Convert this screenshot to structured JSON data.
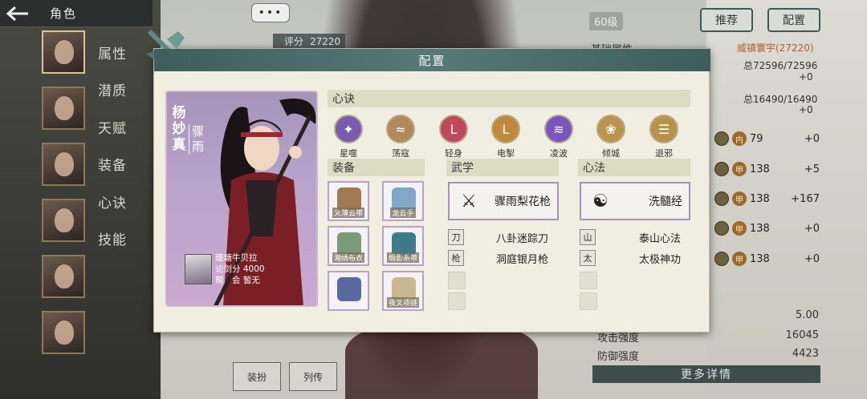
{
  "topbar": {
    "back_icon": "arrow-left-icon",
    "title": "角色"
  },
  "sidebar": {
    "tabs": [
      "属性",
      "潜质",
      "天赋",
      "装备",
      "心诀",
      "技能"
    ]
  },
  "background": {
    "chat_bubble": "•••",
    "score_label": "评分",
    "score_value": "27220",
    "level": "60级",
    "recommend_button": "推荐",
    "config_button": "配置",
    "base_attr_title": "基础属性",
    "base_attr_value": "威镇寰宇(27220)",
    "hp_line": "总72596/72596",
    "hp_plus": "+0",
    "mp_line": "总16490/16490",
    "mp_plus": "+0",
    "stat_rows": [
      {
        "badge": "内",
        "n1": "79",
        "n2": "+0"
      },
      {
        "badge": "甲",
        "n1": "138",
        "n2": "+5"
      },
      {
        "badge": "甲",
        "n1": "138",
        "n2": "+167"
      },
      {
        "badge": "甲",
        "n1": "138",
        "n2": "+0"
      },
      {
        "badge": "甲",
        "n1": "138",
        "n2": "+0"
      }
    ],
    "bottom_stats": [
      {
        "label": "",
        "value": "5.00"
      },
      {
        "label": "攻击强度",
        "value": "16045"
      },
      {
        "label": "防御强度",
        "value": "4423"
      }
    ],
    "more_button": "更多详情",
    "bottom_btn1": "装扮",
    "bottom_btn2": "列传"
  },
  "modal": {
    "title": "配置",
    "character": {
      "name": "杨妙真",
      "title": "骤雨",
      "owner_name": "理塘牛贝拉",
      "score_line": "论剑分 4000",
      "guild_line": "帮　会 暂无"
    },
    "xinjue_header": "心诀",
    "xinjue": [
      {
        "label": "星噬",
        "icon": "star-swirl-icon",
        "color": "#7b5bb0"
      },
      {
        "label": "荡寇",
        "icon": "wave-icon",
        "color": "#b08a5a"
      },
      {
        "label": "轻身",
        "icon": "swift-icon",
        "color": "#c0485a"
      },
      {
        "label": "电掣",
        "icon": "lightning-icon",
        "color": "#c08a3a"
      },
      {
        "label": "凌波",
        "icon": "ripple-icon",
        "color": "#7a55c0"
      },
      {
        "label": "倾城",
        "icon": "beauty-icon",
        "color": "#b9944a"
      },
      {
        "label": "退邪",
        "icon": "ward-icon",
        "color": "#b89448"
      }
    ],
    "equip_header": "装备",
    "equip": [
      {
        "label": "义薄云带",
        "icon": "bead-necklace-icon",
        "color": "#a07a50"
      },
      {
        "label": "龙云手",
        "icon": "gauntlet-icon",
        "color": "#7fa8c8"
      },
      {
        "label": "湘绣布衣",
        "icon": "robe-icon",
        "color": "#7a9a7a"
      },
      {
        "label": "缎影系带",
        "icon": "belt-icon",
        "color": "#3f7a8a"
      },
      {
        "label": "",
        "icon": "boots-icon",
        "color": "#5a6aa0"
      },
      {
        "label": "夜叉项链",
        "icon": "necklace-icon",
        "color": "#c8b890"
      }
    ],
    "wuxue_header": "武学",
    "wuxue_main": "骤雨梨花枪",
    "wuxue_list": [
      "八卦迷踪刀",
      "洞庭银月枪"
    ],
    "xinfa_header": "心法",
    "xinfa_main": "洗髓经",
    "xinfa_list": [
      "泰山心法",
      "太极神功"
    ]
  }
}
